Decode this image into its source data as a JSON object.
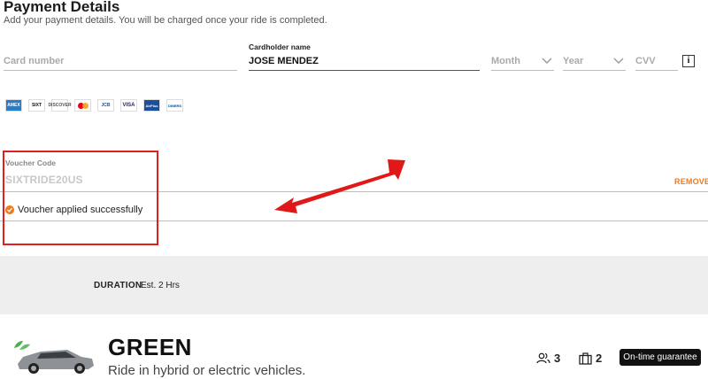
{
  "header": {
    "title": "Payment Details",
    "subtitle": "Add your payment details. You will be charged once your ride is completed."
  },
  "form": {
    "card_number_placeholder": "Card number",
    "cardholder_label": "Cardholder name",
    "cardholder_value": "JOSE MENDEZ",
    "month_placeholder": "Month",
    "year_placeholder": "Year",
    "cvv_placeholder": "CVV",
    "info_icon": "i"
  },
  "card_brands": [
    "AMEX",
    "SIXT",
    "DISCOVER",
    "MC",
    "JCB",
    "VISA",
    "AirPlus",
    "DINERS"
  ],
  "voucher": {
    "label": "Voucher Code",
    "value": "SIXTRIDE20US",
    "remove_label": "REMOVE",
    "success_text": "Voucher applied successfully"
  },
  "duration": {
    "label": "DURATION",
    "value": "Est. 2 Hrs"
  },
  "vehicle": {
    "name": "GREEN",
    "description": "Ride in hybrid or electric vehicles.",
    "passengers": "3",
    "bags": "2",
    "badge": "On-time guarantee"
  },
  "colors": {
    "accent": "#f0781e",
    "highlight": "#e02020",
    "band": "#eeeeee"
  }
}
